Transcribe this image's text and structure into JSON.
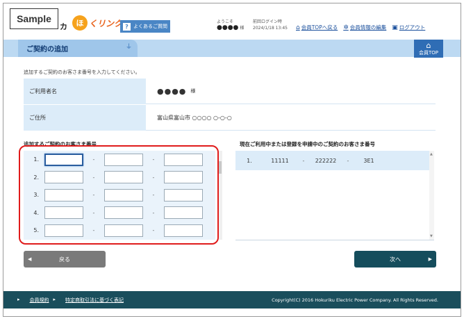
{
  "sample_label": "Sample",
  "logo": {
    "fragment": "カ",
    "mark": "ほ",
    "rest": "くリンク"
  },
  "header": {
    "faq_label": "よくあるご質問",
    "welcome_label": "ようこそ",
    "user_name": "●●●●",
    "honorific": "様",
    "last_login_label": "前回ログイン時",
    "last_login_value": "2024/1/18 13:45",
    "links": [
      {
        "label": "会員TOPへ戻る",
        "icon": "home-icon",
        "glyph": "⌂"
      },
      {
        "label": "会員情報の編集",
        "icon": "gear-icon",
        "glyph": "✲"
      },
      {
        "label": "ログアウト",
        "icon": "logout-icon",
        "glyph": "▣"
      }
    ]
  },
  "page_title": "ご契約の追加",
  "member_top_label": "会員TOP",
  "instruction": "追加するご契約のお客さま番号を入力してください。",
  "info": [
    {
      "label": "ご利用者名",
      "value": "●●●●",
      "suffix": "様"
    },
    {
      "label": "ご住所",
      "value": "富山県富山市 ○○○○ ○-○-○"
    }
  ],
  "left_section_title": "追加するご契約のお客さま番号",
  "right_section_title": "現在ご利用中または登録を申請中のご契約のお客さま番号",
  "input_rows": [
    "1.",
    "2.",
    "3.",
    "4.",
    "5."
  ],
  "dash": "-",
  "existing": [
    {
      "num": "1.",
      "v1": "11111",
      "v2": "222222",
      "v3": "3E1"
    }
  ],
  "buttons": {
    "back": "戻る",
    "next": "次へ"
  },
  "footer": {
    "links": [
      "会員規約",
      "特定商取引法に基づく表記"
    ],
    "copyright": "Copyright(C) 2016 Hokuriku Electric Power Company. All Rights Reserved."
  },
  "colors": {
    "accent": "#2f6db5",
    "highlight": "#e01b1b",
    "footer": "#1a4e5c",
    "panel": "#dcecf9"
  }
}
